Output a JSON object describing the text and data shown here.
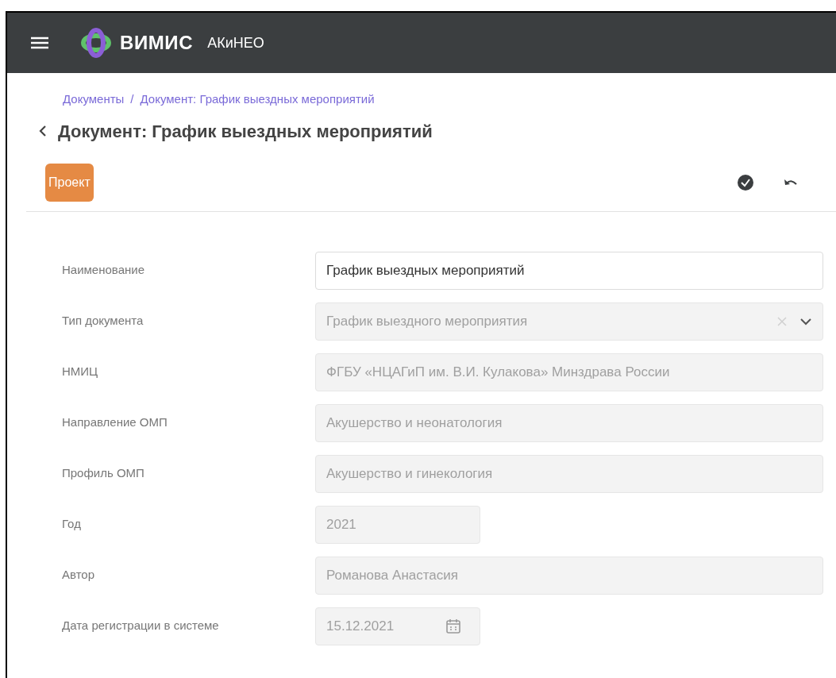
{
  "header": {
    "logo_text": "ВИМИС",
    "subtitle": "АКиНЕО"
  },
  "breadcrumbs": [
    {
      "label": "Документы"
    },
    {
      "label": "Документ: График выездных мероприятий"
    }
  ],
  "breadcrumb_separator": "/",
  "title": "Документ: График выездных мероприятий",
  "status_button": "Проект",
  "fields": [
    {
      "label": "Наименование",
      "value": "График выездных мероприятий",
      "kind": "text",
      "disabled": false
    },
    {
      "label": "Тип документа",
      "value": "График выездного мероприятия",
      "kind": "select",
      "disabled": true
    },
    {
      "label": "НМИЦ",
      "value": "ФГБУ «НЦАГиП им. В.И. Кулакова» Минздрава России",
      "kind": "text",
      "disabled": true
    },
    {
      "label": "Направление ОМП",
      "value": "Акушерство и неонатология",
      "kind": "text",
      "disabled": true
    },
    {
      "label": "Профиль ОМП",
      "value": "Акушерство и гинекология",
      "kind": "text",
      "disabled": true
    },
    {
      "label": "Год",
      "value": "2021",
      "kind": "short",
      "disabled": true
    },
    {
      "label": "Автор",
      "value": "Романова Анастасия",
      "kind": "text",
      "disabled": true
    },
    {
      "label": "Дата регистрации в системе",
      "value": "15.12.2021",
      "kind": "date",
      "disabled": true
    }
  ]
}
